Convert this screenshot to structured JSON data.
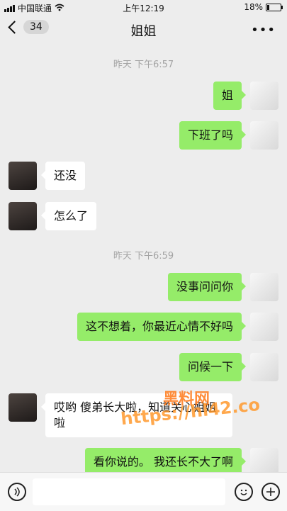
{
  "status": {
    "carrier": "中国联通",
    "time": "上午12:19",
    "battery_percent": "18%",
    "battery_level": 0.18
  },
  "header": {
    "unread_count": "34",
    "title": "姐姐",
    "more": "•••"
  },
  "timestamps": [
    "昨天 下午6:57",
    "昨天 下午6:59"
  ],
  "messages": [
    {
      "from": "me",
      "text": "姐"
    },
    {
      "from": "me",
      "text": "下班了吗"
    },
    {
      "from": "sister",
      "text": "还没"
    },
    {
      "from": "sister",
      "text": "怎么了"
    },
    {
      "from": "me",
      "text": "没事问问你"
    },
    {
      "from": "me",
      "text": "这不想着，你最近心情不好吗"
    },
    {
      "from": "me",
      "text": "问候一下"
    },
    {
      "from": "sister",
      "text": "哎哟 傻弟长大啦，知道关心姐姐啦"
    },
    {
      "from": "me",
      "text": "看你说的。 我还长不大了啊"
    }
  ],
  "watermark": {
    "line1": "黑料网",
    "line2": "https://hl42.co"
  },
  "colors": {
    "outgoing_bubble": "#95ec69",
    "incoming_bubble": "#ffffff",
    "background": "#ededed"
  },
  "icons": {
    "voice": "voice-icon",
    "emoji": "emoji-icon",
    "plus": "plus-icon"
  }
}
